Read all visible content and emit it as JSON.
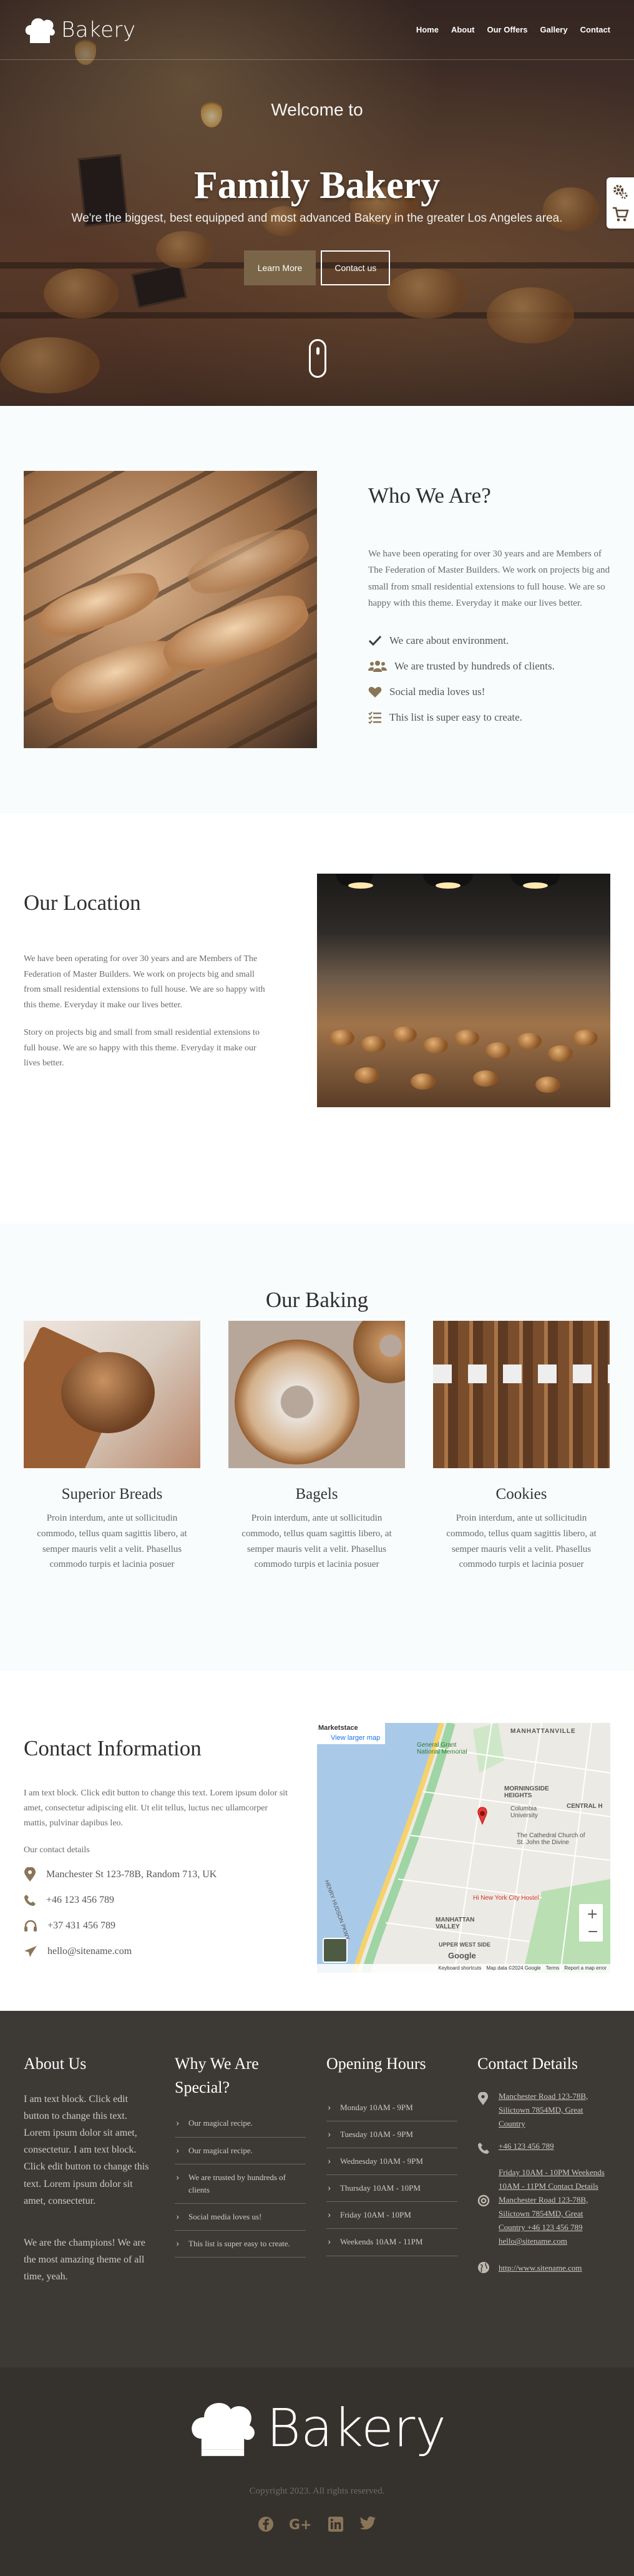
{
  "brand": {
    "name": "Bakery"
  },
  "nav": {
    "items": [
      "Home",
      "About",
      "Our Offers",
      "Gallery",
      "Contact"
    ]
  },
  "hero": {
    "welcome": "Welcome to",
    "title": "Family Bakery",
    "subtitle": "We're the biggest, best equipped and most advanced Bakery in the greater Los Angeles area.",
    "learn_more": "Learn More",
    "contact_us": "Contact us",
    "side_icons": [
      "gear-icon",
      "cart-icon"
    ]
  },
  "who": {
    "title": "Who We Are?",
    "text": "We have been operating for over 30 years and are Members of The Federation of Master Builders. We work on projects big and small from small residential extensions to full house. We are so happy with this theme. Everyday it make our lives better.",
    "features": [
      {
        "icon": "check-icon",
        "text": "We care about environment."
      },
      {
        "icon": "users-icon",
        "text": "We are trusted by hundreds of clients."
      },
      {
        "icon": "heart-icon",
        "text": "Social media loves us!"
      },
      {
        "icon": "list-icon",
        "text": "This list is super easy to create."
      }
    ]
  },
  "location": {
    "title": "Our Location",
    "text1": "We have been operating for over 30 years and are Members of The Federation of Master Builders. We work on projects big and small from small residential extensions to full house. We are so happy with this theme. Everyday it make our lives better.",
    "text2": "Story on projects big and small from small residential extensions to full house. We are so happy with this theme. Everyday it make our lives better."
  },
  "baking": {
    "title": "Our Baking",
    "items": [
      {
        "name": "Superior Breads",
        "text": "Proin interdum, ante ut sollicitudin commodo, tellus quam sagittis libero, at semper mauris velit a velit. Phasellus commodo turpis et lacinia posuer"
      },
      {
        "name": "Bagels",
        "text": "Proin interdum, ante ut sollicitudin commodo, tellus quam sagittis libero, at semper mauris velit a velit. Phasellus commodo turpis et lacinia posuer"
      },
      {
        "name": "Cookies",
        "text": "Proin interdum, ante ut sollicitudin commodo, tellus quam sagittis libero, at semper mauris velit a velit. Phasellus commodo turpis et lacinia posuer"
      }
    ]
  },
  "contact": {
    "title": "Contact Information",
    "text": "I am text block. Click edit button to change this text. Lorem ipsum dolor sit amet, consectetur adipiscing elit. Ut elit tellus, luctus nec ullamcorper mattis, pulvinar dapibus leo.",
    "details_label": "Our contact details",
    "items": [
      {
        "icon": "map-marker-icon",
        "text": "Manchester St 123-78B, Random 713, UK"
      },
      {
        "icon": "phone-icon",
        "text": "+46 123 456 789"
      },
      {
        "icon": "headphones-icon",
        "text": "+37 431 456 789"
      },
      {
        "icon": "paper-plane-icon",
        "text": "hello@sitename.com"
      }
    ],
    "map": {
      "place": "Marketstace",
      "view_larger": "View larger map",
      "labels": [
        "MANHATTANVILLE",
        "MORNINGSIDE HEIGHTS",
        "Columbia University",
        "CENTRAL H",
        "The Cathedral Church of St. John the Divine",
        "Hi New York City Hostel",
        "MANHATTAN VALLEY",
        "UPPER WEST SIDE",
        "HENRY HUDSON PKWY",
        "General Grant National Memorial"
      ],
      "footer": [
        "Keyboard shortcuts",
        "Map data ©2024 Google",
        "Terms",
        "Report a map error"
      ],
      "google": "Google"
    }
  },
  "footer": {
    "about_title": "About Us",
    "about_text": "I am text block. Click edit button to change this text. Lorem ipsum dolor sit amet, consectetur. I am text block. Click edit button to change this text. Lorem ipsum dolor sit amet, consectetur.",
    "about_text2": "We are the champions! We are the most amazing theme of all time, yeah.",
    "why_title": "Why We Are Special?",
    "why_items": [
      "Our magical recipe.",
      "Our magical recipe.",
      "We are trusted by hundreds of clients",
      "Social media loves us!",
      "This list is super easy to create."
    ],
    "hours_title": "Opening Hours",
    "hours_items": [
      "Monday 10AM - 9PM",
      "Tuesday 10AM - 9PM",
      "Wednesday 10AM - 9PM",
      "Thursday 10AM - 10PM",
      "Friday 10AM - 10PM",
      "Weekends 10AM - 11PM"
    ],
    "contact_title": "Contact Details",
    "contact_address": "Manchester Road 123-78B, Silictown 7854MD, Great Country",
    "contact_phone": "+46 123 456 789",
    "contact_mixed": "Friday 10AM - 10PM Weekends 10AM - 11PM Contact Details Manchester Road 123-78B, Silictown 7854MD, Great Country +46 123 456 789 hello@sitename.com",
    "contact_web": "http://www.sitename.com",
    "copyright": "Copyright 2023. All rights reserved.",
    "socials": [
      "facebook-icon",
      "google-plus-icon",
      "linkedin-icon",
      "twitter-icon"
    ]
  },
  "colors": {
    "accent": "#7a6548",
    "footer_bg": "#3d3a35",
    "footer_bottom_bg": "#35322e",
    "icon": "#8a7558",
    "section_alt": "#f8fcfd"
  }
}
